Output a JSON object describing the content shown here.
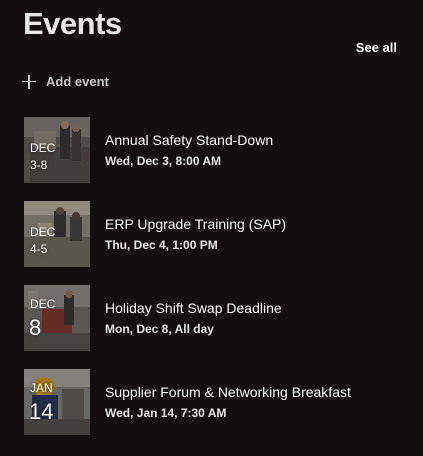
{
  "header": {
    "title": "Events",
    "see_all": "See all"
  },
  "add_event": {
    "label": "Add event",
    "icon": "plus-icon"
  },
  "events": [
    {
      "month": "DEC",
      "range": "3-8",
      "title": "Annual Safety Stand-Down",
      "when": "Wed, Dec 3, 8:00 AM"
    },
    {
      "month": "DEC",
      "range": "4-5",
      "title": "ERP Upgrade Training (SAP)",
      "when": "Thu, Dec 4, 1:00 PM"
    },
    {
      "month": "DEC",
      "day": "8",
      "title": "Holiday Shift Swap Deadline",
      "when": "Mon, Dec 8, All day"
    },
    {
      "month": "JAN",
      "day": "14",
      "title": "Supplier Forum & Networking Breakfast",
      "when": "Wed, Jan 14, 7:30 AM"
    }
  ]
}
